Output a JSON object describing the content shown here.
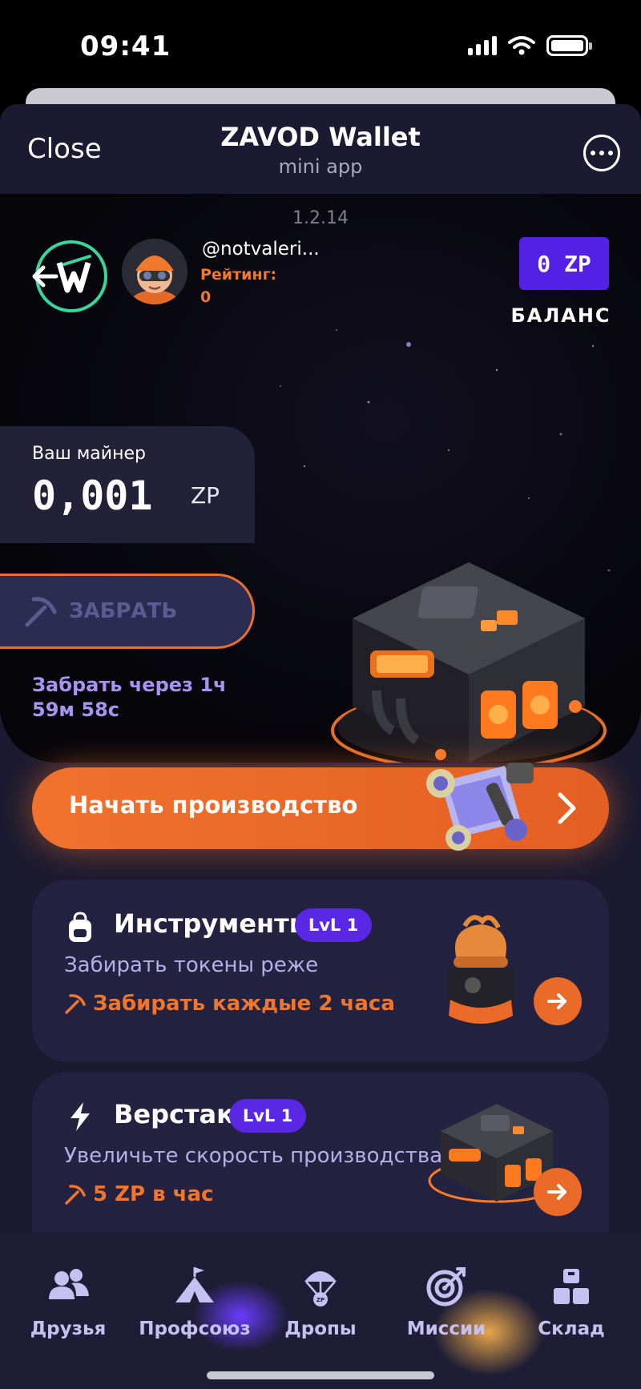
{
  "status_bar": {
    "time": "09:41"
  },
  "top_bar": {
    "close_label": "Close",
    "title": "ZAVOD Wallet",
    "subtitle": "mini app"
  },
  "header": {
    "version": "1.2.14",
    "username": "@notvaleri...",
    "rating_label": "Рейтинг:",
    "rating_value": "0",
    "balance_value": "0 ZP",
    "balance_label": "БАЛАНС"
  },
  "miner": {
    "label": "Ваш майнер",
    "value": "0,001",
    "unit": "ZP",
    "claim_label": "ЗАБРАТЬ",
    "timer_text": "Забрать через 1ч 59м 58с"
  },
  "start_button": {
    "label": "Начать производство"
  },
  "cards": [
    {
      "title": "Инструменты",
      "level": "LvL 1",
      "description": "Забирать токены реже",
      "perk": "Забирать каждые 2 часа",
      "icon": "backpack-icon"
    },
    {
      "title": "Верстак",
      "level": "LvL 1",
      "description": "Увеличьте скорость производства",
      "perk": "5 ZP в час",
      "icon": "lightning-icon"
    }
  ],
  "nav": [
    {
      "label": "Друзья",
      "icon": "friends-icon"
    },
    {
      "label": "Профсоюз",
      "icon": "union-tent-icon"
    },
    {
      "label": "Дропы",
      "icon": "parachute-icon"
    },
    {
      "label": "Миссии",
      "icon": "target-icon"
    },
    {
      "label": "Склад",
      "icon": "boxes-icon"
    }
  ],
  "colors": {
    "accent_orange": "#F0722D",
    "accent_purple": "#5A28E4",
    "background": "#1B1A30"
  }
}
